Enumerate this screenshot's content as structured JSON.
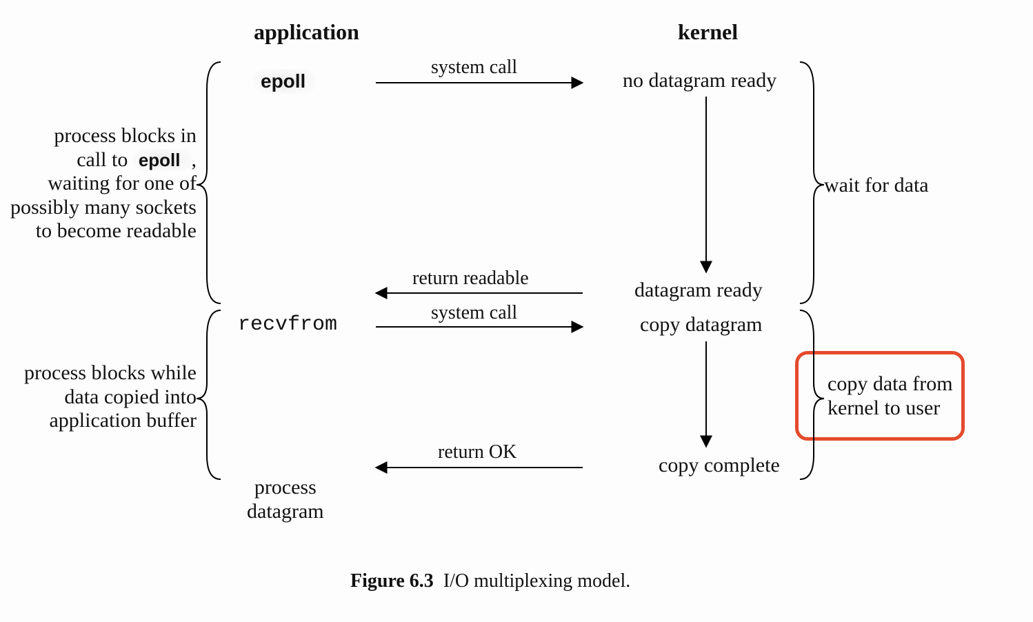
{
  "columns": {
    "application": "application",
    "kernel": "kernel"
  },
  "app": {
    "call1_label": "epoll",
    "call2_label": "recvfrom",
    "after_label": "process\ndatagram",
    "brace1_text": "process blocks in\ncall to  epoll      ,\nwaiting for one of\npossibly many sockets\nto become readable",
    "brace1_epoll": "epoll",
    "brace2_text": "process blocks while\ndata copied into\napplication buffer"
  },
  "arrows": {
    "a1_label": "system call",
    "a2_label": "return readable",
    "a3_label": "system call",
    "a4_label": "return OK"
  },
  "kernel": {
    "state1": "no datagram ready",
    "state2": "datagram ready",
    "state3": "copy datagram",
    "state4": "copy complete",
    "brace1_text": "wait for data",
    "brace2_text": "copy data from\nkernel to user"
  },
  "caption": {
    "bold": "Figure 6.3",
    "rest": "  I/O multiplexing model."
  },
  "colors": {
    "highlight": "#e44a2c"
  }
}
